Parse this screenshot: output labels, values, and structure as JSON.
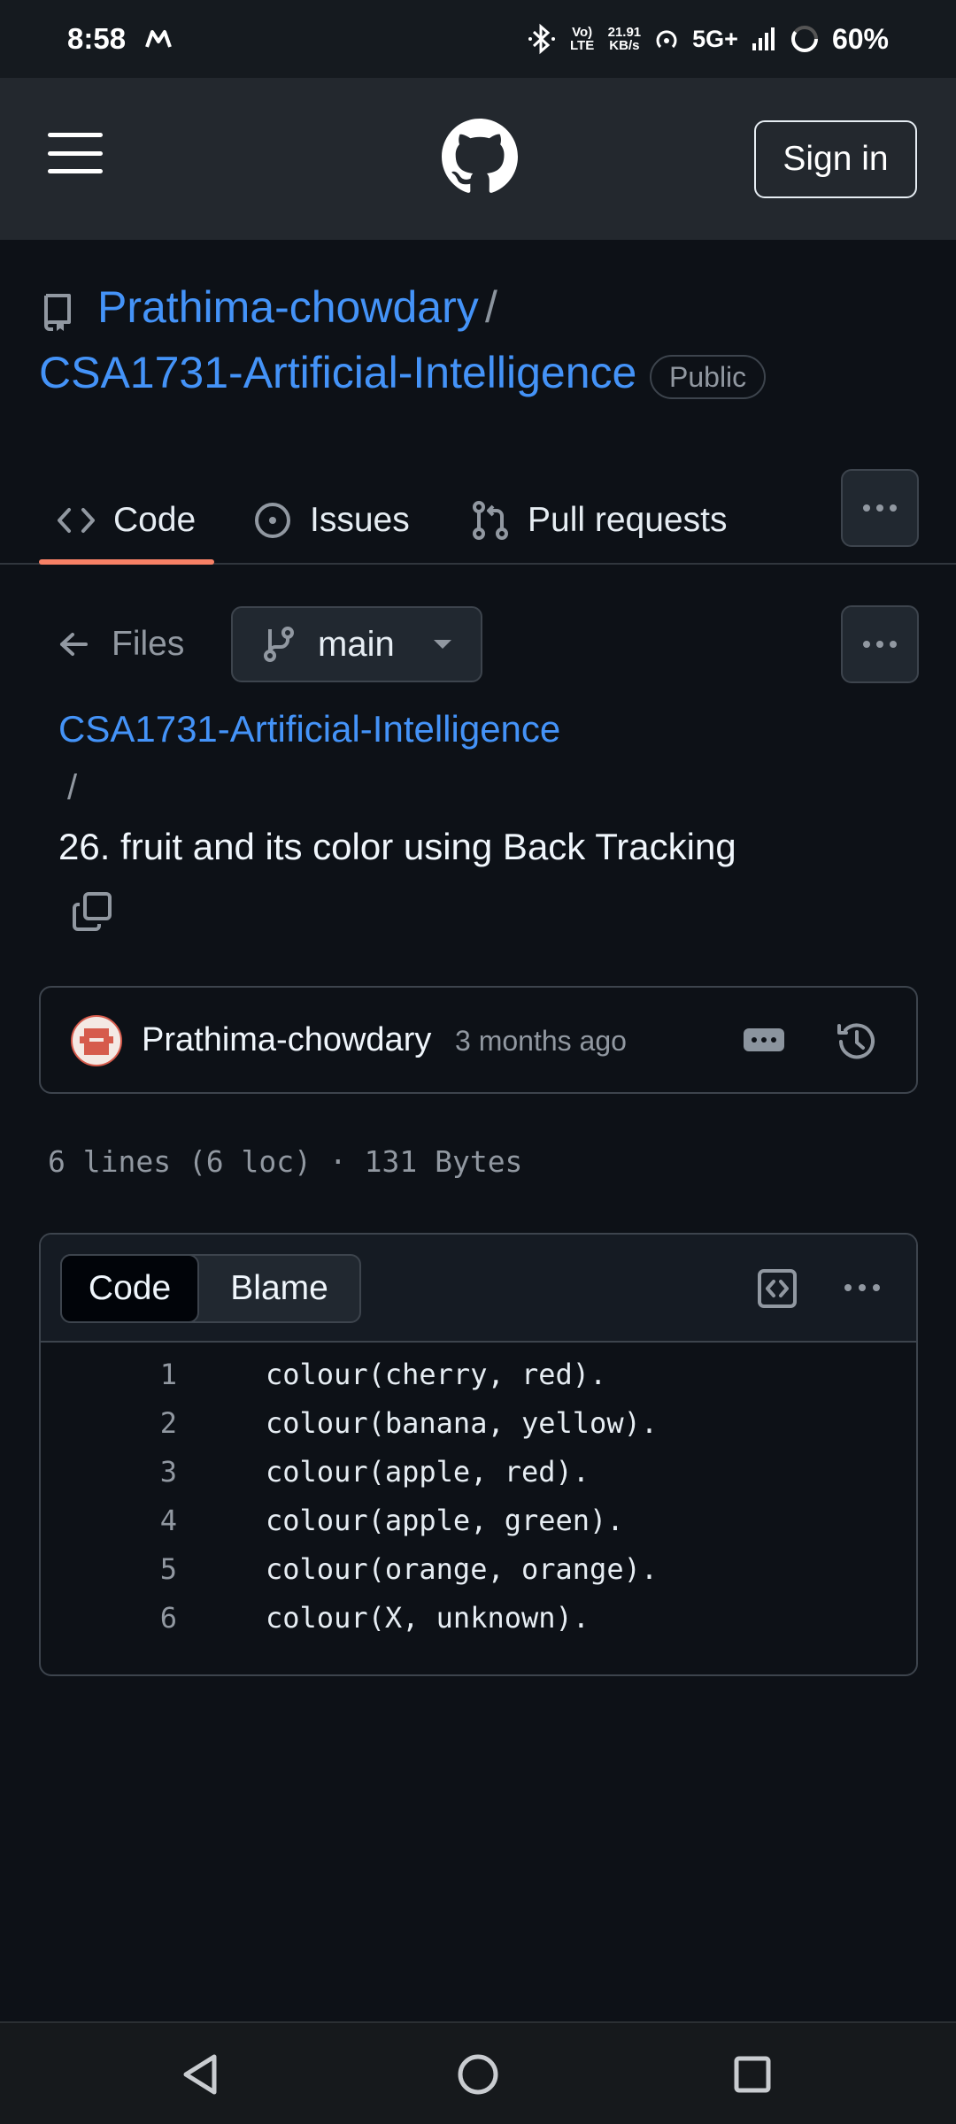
{
  "status_bar": {
    "time": "8:58",
    "carrier_icon": "m-logo-icon",
    "volte": "Vo) LTE",
    "speed_value": "21.91",
    "speed_unit": "KB/s",
    "network": "5G+",
    "battery": "60%"
  },
  "header": {
    "menu_icon": "hamburger-menu-icon",
    "logo_icon": "github-octocat-icon",
    "sign_in": "Sign in"
  },
  "repo": {
    "owner": "Prathima-chowdary",
    "separator": "/",
    "name": "CSA1731-Artificial-Intelligence",
    "visibility": "Public"
  },
  "tabs": [
    {
      "label": "Code",
      "icon": "code-icon",
      "active": true
    },
    {
      "label": "Issues",
      "icon": "issue-opened-icon",
      "active": false
    },
    {
      "label": "Pull requests",
      "icon": "git-pull-request-icon",
      "active": false
    }
  ],
  "file_nav": {
    "files_label": "Files",
    "branch": "main"
  },
  "breadcrumb": {
    "repo": "CSA1731-Artificial-Intelligence",
    "separator": "/",
    "file": "26. fruit and its color using Back Tracking"
  },
  "commit": {
    "author": "Prathima-chowdary",
    "time": "3 months ago"
  },
  "file_meta": "6 lines (6 loc) · 131 Bytes",
  "code_view": {
    "tab_code": "Code",
    "tab_blame": "Blame",
    "lines": [
      {
        "num": "1",
        "text": "colour(cherry, red)."
      },
      {
        "num": "2",
        "text": "colour(banana, yellow)."
      },
      {
        "num": "3",
        "text": "colour(apple, red)."
      },
      {
        "num": "4",
        "text": "colour(apple, green)."
      },
      {
        "num": "5",
        "text": "colour(orange, orange)."
      },
      {
        "num": "6",
        "text": "colour(X, unknown)."
      }
    ]
  },
  "colors": {
    "background": "#0d1117",
    "header": "#23282e",
    "link": "#4493f8",
    "active_tab_underline": "#f78166",
    "border": "#3d444d"
  }
}
